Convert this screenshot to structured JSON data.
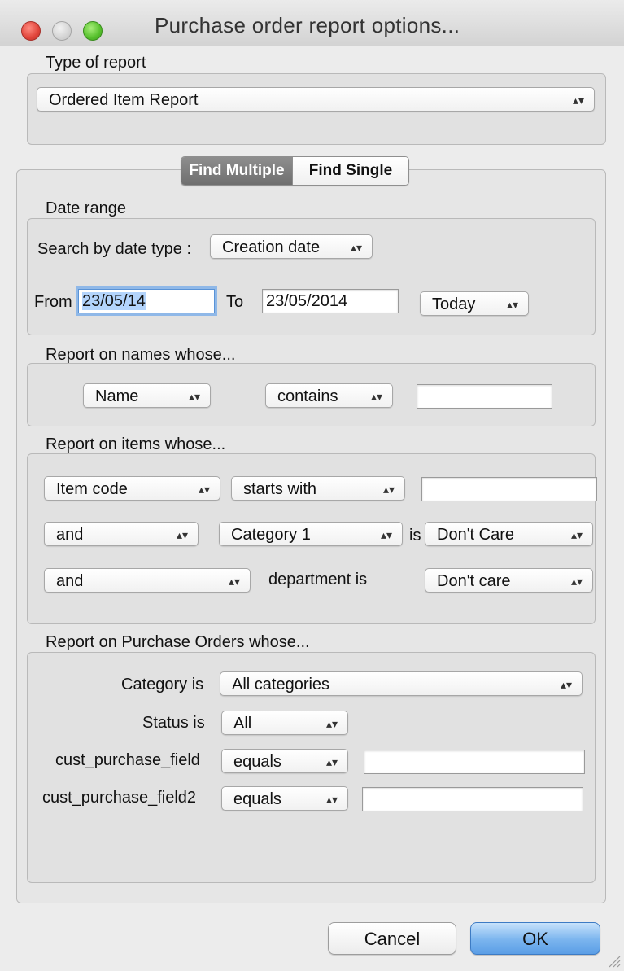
{
  "window": {
    "title": "Purchase order report options..."
  },
  "type_of_report": {
    "label": "Type of report",
    "selected": "Ordered Item Report"
  },
  "tabs": {
    "find_multiple": "Find Multiple",
    "find_single": "Find Single"
  },
  "date_range": {
    "label": "Date range",
    "search_by_label": "Search by date type :",
    "date_type": "Creation date",
    "from_label": "From",
    "from_value": "23/05/14",
    "to_label": "To",
    "to_value": "23/05/2014",
    "preset": "Today"
  },
  "names": {
    "label": "Report on names whose...",
    "field": "Name",
    "operator": "contains",
    "value": ""
  },
  "items": {
    "label": "Report on items whose...",
    "row1": {
      "field": "Item code",
      "operator": "starts with",
      "value": ""
    },
    "row2": {
      "conjunction": "and",
      "field": "Category 1",
      "is_label": "is",
      "value": "Don't Care"
    },
    "row3": {
      "conjunction": "and",
      "text": "department is",
      "value": "Don't care"
    }
  },
  "purchase_orders": {
    "label": "Report on Purchase Orders whose...",
    "category_label": "Category is",
    "category": "All categories",
    "status_label": "Status is",
    "status": "All",
    "cust1_label": "cust_purchase_field",
    "cust1_operator": "equals",
    "cust1_value": "",
    "cust2_label": "cust_purchase_field2",
    "cust2_operator": "equals",
    "cust2_value": ""
  },
  "buttons": {
    "cancel": "Cancel",
    "ok": "OK"
  },
  "colors": {
    "ok_button": "#7ab4ee",
    "active_tab": "#7d7d7d",
    "close": "#e0443a",
    "zoom": "#56c02c"
  }
}
